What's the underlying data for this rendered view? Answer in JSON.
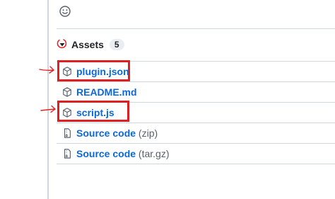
{
  "assets": {
    "title": "Assets",
    "count": "5",
    "items": [
      {
        "label": "plugin.json",
        "suffix": "",
        "icon": "package-icon"
      },
      {
        "label": "README.md",
        "suffix": "",
        "icon": "package-icon"
      },
      {
        "label": "script.js",
        "suffix": "",
        "icon": "package-icon"
      },
      {
        "label": "Source code",
        "suffix": "(zip)",
        "icon": "file-zip-icon"
      },
      {
        "label": "Source code",
        "suffix": "(tar.gz)",
        "icon": "file-zip-icon"
      }
    ]
  },
  "colors": {
    "link": "#0969da",
    "annotation": "#e02020",
    "border": "#d0d7de"
  }
}
